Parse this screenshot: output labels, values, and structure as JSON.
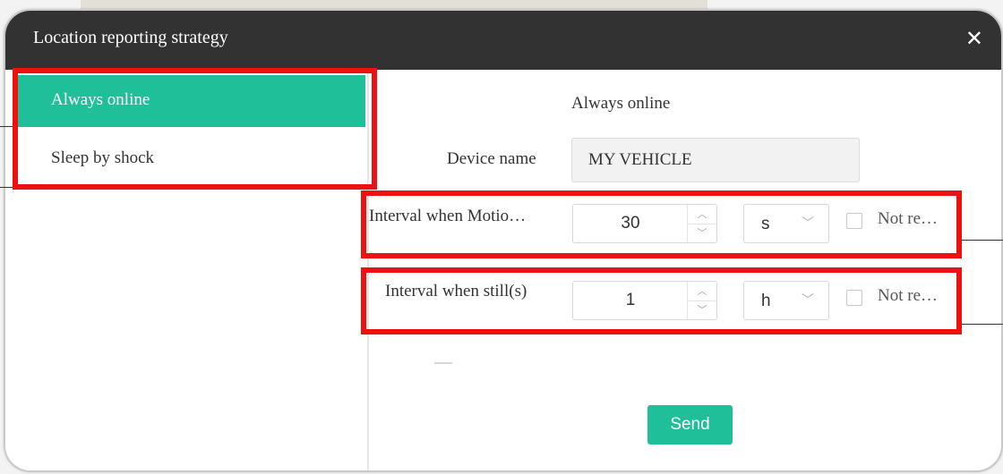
{
  "dialog": {
    "title": "Location reporting strategy",
    "close_glyph": "✕"
  },
  "sidebar": {
    "items": [
      {
        "label": "Always online",
        "active": true
      },
      {
        "label": "Sleep by shock",
        "active": false
      }
    ]
  },
  "form": {
    "heading": "Always online",
    "device_name_label": "Device name",
    "device_name_value": "MY VEHICLE",
    "motion": {
      "label": "Interval when Motio…",
      "value": "30",
      "unit": "s",
      "checkbox_label": "Not re…",
      "checked": false
    },
    "still": {
      "label": "Interval when still(s)",
      "value": "1",
      "unit": "h",
      "checkbox_label": "Not re…",
      "checked": false
    },
    "send_label": "Send"
  },
  "glyphs": {
    "up": "︿",
    "down": "﹀",
    "chevron_down": "﹀"
  },
  "colors": {
    "accent": "#1fbf9a",
    "titlebar": "#323232",
    "highlight": "#ee1111"
  }
}
